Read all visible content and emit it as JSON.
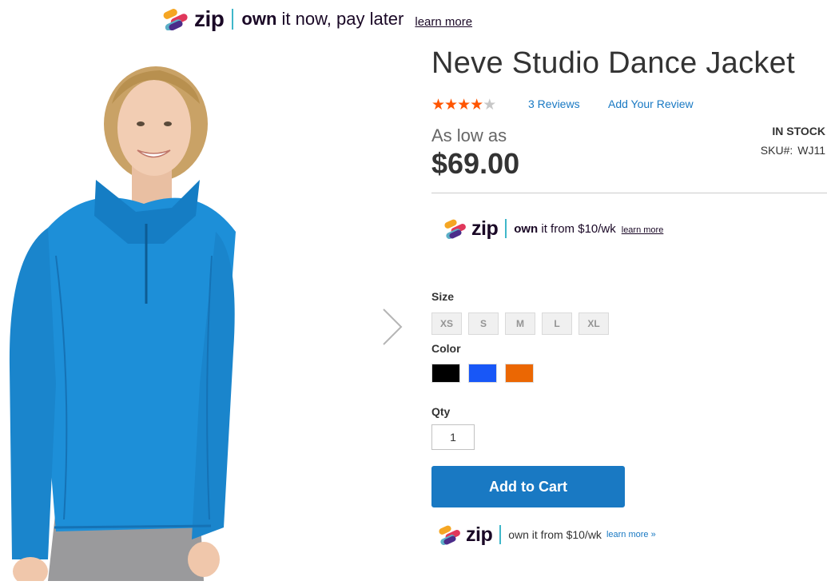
{
  "zip_banner_top": {
    "brand": "zip",
    "tagline_bold": "own",
    "tagline_rest": " it now, pay later",
    "learn_more": "learn more"
  },
  "product": {
    "title": "Neve Studio Dance Jacket",
    "rating_percent": 80,
    "reviews_link": "3  Reviews",
    "add_review_link": "Add Your Review",
    "price_prefix": "As low as",
    "price": "$69.00",
    "stock_status": "IN STOCK",
    "sku_label": "SKU#:",
    "sku_value": "WJ11"
  },
  "zip_banner_mid": {
    "brand": "zip",
    "tagline_bold": "own",
    "tagline_rest": " it from $10/wk",
    "learn_more": "learn more"
  },
  "options": {
    "size_label": "Size",
    "sizes": [
      "XS",
      "S",
      "M",
      "L",
      "XL"
    ],
    "color_label": "Color",
    "colors": [
      {
        "name": "Black",
        "hex": "#000000"
      },
      {
        "name": "Blue",
        "hex": "#1857f7"
      },
      {
        "name": "Orange",
        "hex": "#eb6703"
      }
    ]
  },
  "qty": {
    "label": "Qty",
    "value": "1"
  },
  "cart": {
    "button_label": "Add to Cart"
  },
  "zip_banner_bottom": {
    "brand": "zip",
    "tagline": "own it from $10/wk",
    "learn_more": "learn more »"
  },
  "colors": {
    "accent": "#1979c3",
    "star": "#ff5501",
    "zip_dark": "#1a0826",
    "zip_divider": "#3fb7c9"
  },
  "icons": {
    "next": "chevron-right-icon",
    "zip_logo": "zip-logo-icon"
  }
}
